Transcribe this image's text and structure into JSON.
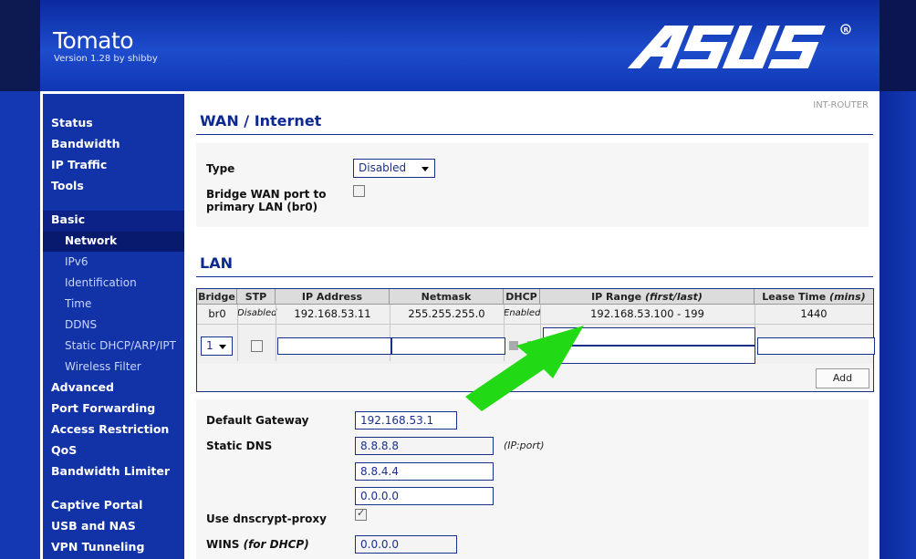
{
  "app": {
    "title": "Tomato",
    "version": "Version 1.28 by shibby",
    "brand": "ASUS",
    "router_name": "INT-ROUTER"
  },
  "sidebar": {
    "items": [
      {
        "label": "Status"
      },
      {
        "label": "Bandwidth"
      },
      {
        "label": "IP Traffic"
      },
      {
        "label": "Tools"
      },
      {
        "label": "Basic"
      },
      {
        "label": "Network"
      },
      {
        "label": "IPv6"
      },
      {
        "label": "Identification"
      },
      {
        "label": "Time"
      },
      {
        "label": "DDNS"
      },
      {
        "label": "Static DHCP/ARP/IPT"
      },
      {
        "label": "Wireless Filter"
      },
      {
        "label": "Advanced"
      },
      {
        "label": "Port Forwarding"
      },
      {
        "label": "Access Restriction"
      },
      {
        "label": "QoS"
      },
      {
        "label": "Bandwidth Limiter"
      },
      {
        "label": "Captive Portal"
      },
      {
        "label": "USB and NAS"
      },
      {
        "label": "VPN Tunneling"
      }
    ],
    "selected": "Network"
  },
  "wan": {
    "title": "WAN / Internet",
    "type_label": "Type",
    "type_value": "Disabled",
    "bridge_label_1": "Bridge WAN port to",
    "bridge_label_2": "primary LAN (br0)"
  },
  "lan": {
    "title": "LAN",
    "columns": [
      "Bridge",
      "STP",
      "IP Address",
      "Netmask",
      "DHCP",
      "IP Range",
      "Lease Time"
    ],
    "ip_range_suffix": "(first/last)",
    "lease_suffix": "(mins)",
    "row": {
      "bridge": "br0",
      "stp": "Disabled",
      "ip": "192.168.53.11",
      "netmask": "255.255.255.0",
      "dhcp": "Enabled",
      "range": "192.168.53.100 - 199",
      "lease": "1440"
    },
    "new_bridge_value": "1",
    "add_label": "Add"
  },
  "settings": {
    "gateway_label": "Default Gateway",
    "gateway_value": "192.168.53.1",
    "dns_label": "Static DNS",
    "dns_hint": "(IP:port)",
    "dns": [
      "8.8.8.8",
      "8.8.4.4",
      "0.0.0.0"
    ],
    "dnscrypt_label": "Use dnscrypt-proxy",
    "wins_label": "WINS",
    "wins_suffix": "(for DHCP)",
    "wins_value": "0.0.0.0"
  },
  "colors": {
    "accent": "#0c2a8f",
    "sidebar": "#1232a8",
    "arrow": "#22d915"
  }
}
